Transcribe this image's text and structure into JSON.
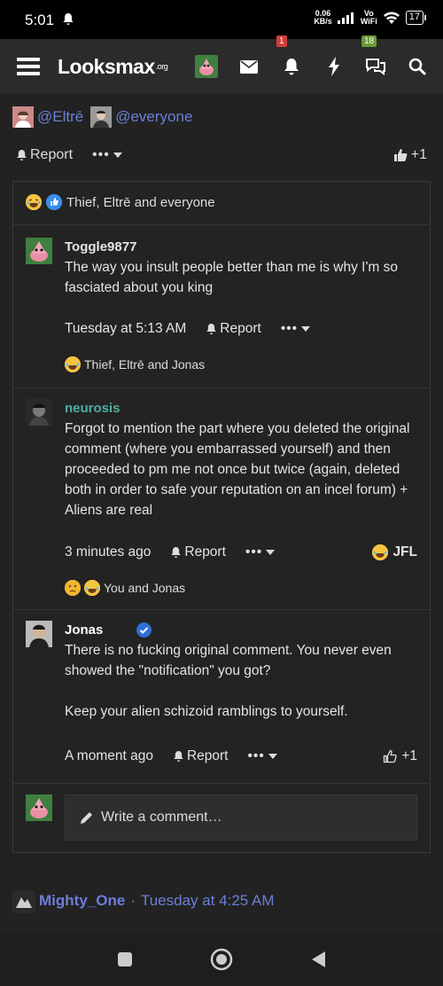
{
  "status_bar": {
    "time": "5:01",
    "net_speed": "0.06",
    "net_unit": "KB/s",
    "volte_top": "Vo",
    "volte_bottom": "WiFi",
    "battery": "17"
  },
  "nav": {
    "logo_main": "Looksmax",
    "logo_suffix": ".org",
    "alerts_badge": "1",
    "conversations_badge": "18"
  },
  "post": {
    "mentions": [
      "@Eltrē",
      "@everyone"
    ],
    "report_label": "Report",
    "like_count": "+1"
  },
  "reaction_summary": "Thief, Eltrē and everyone",
  "comments": [
    {
      "author": "Toggle9877",
      "author_color": "#6b7fd8",
      "text": "The way you insult people better than me is why I'm so fasciated about you king",
      "time": "Tuesday at 5:13 AM",
      "report_label": "Report",
      "reactions": "Thief, Eltrē and Jonas"
    },
    {
      "author": "neurosis",
      "author_color": "#4fb0a0",
      "text": "Forgot to mention the part where you deleted the original comment (where you embarrassed yourself) and then proceeded to pm me not once but twice (again, deleted both in order to safe your reputation on an incel forum) + Aliens are real",
      "time": "3 minutes ago",
      "report_label": "Report",
      "right_reaction": "JFL",
      "reactions": "You and Jonas"
    },
    {
      "author": "Jonas",
      "author_color": "#ffffff",
      "text_line1": "There is no fucking original comment. You never even showed the \"notification\" you got?",
      "text_line2": "Keep your alien schizoid ramblings to yourself.",
      "time": "A moment ago",
      "report_label": "Report",
      "like_count": "+1"
    }
  ],
  "write_comment_placeholder": "Write a comment…",
  "next_post": {
    "author": "Mighty_One",
    "separator": "·",
    "date": "Tuesday at 4:25 AM"
  }
}
